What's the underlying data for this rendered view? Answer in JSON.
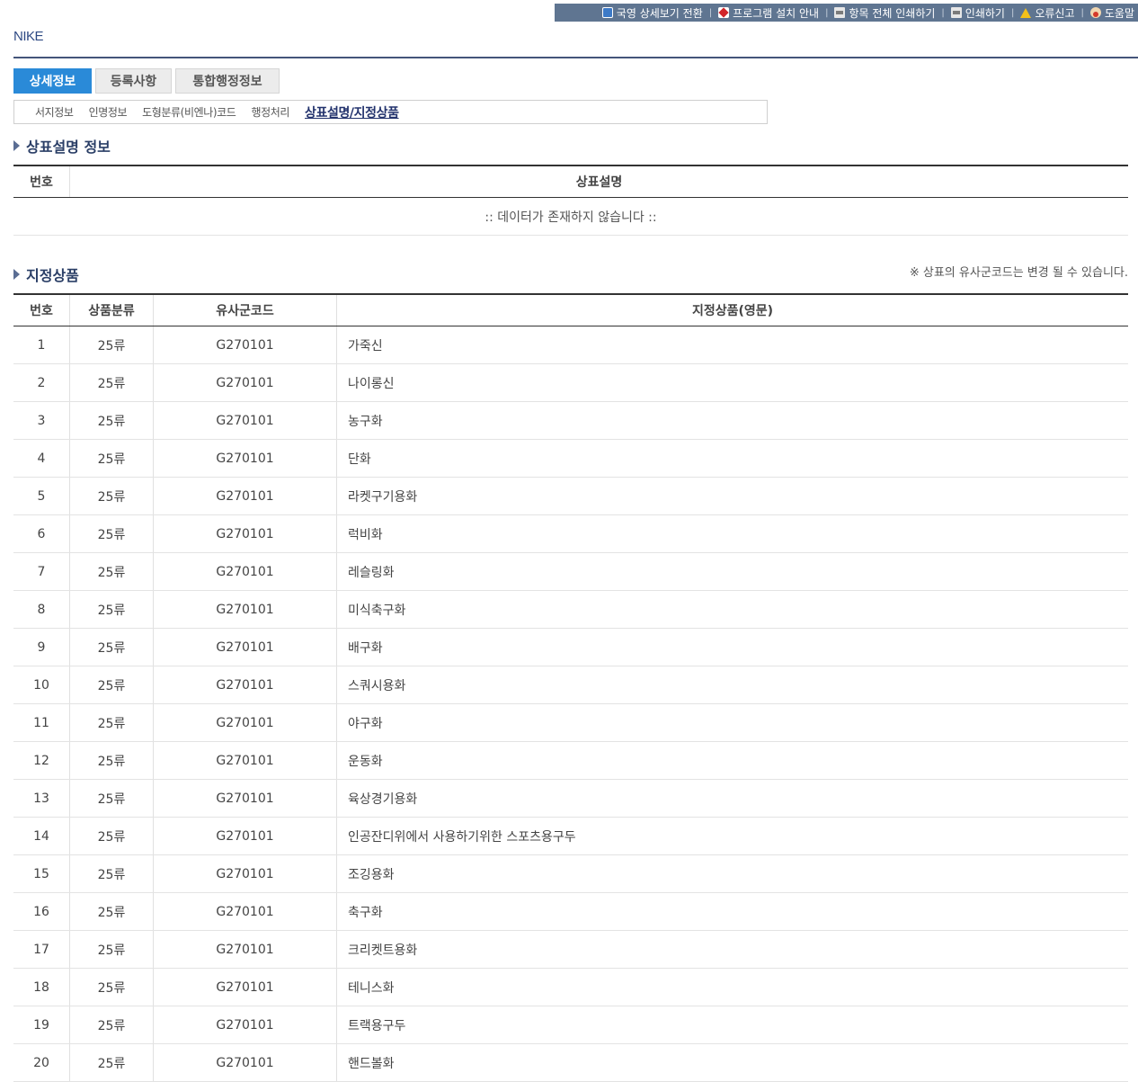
{
  "toolbar": {
    "items": [
      {
        "label": "국영 상세보기 전환",
        "icon": "translate-icon"
      },
      {
        "label": "프로그램 설치 안내",
        "icon": "pdf-icon"
      },
      {
        "label": "항목 전체 인쇄하기",
        "icon": "printer-icon"
      },
      {
        "label": "인쇄하기",
        "icon": "printer-icon"
      },
      {
        "label": "오류신고",
        "icon": "warning-icon"
      },
      {
        "label": "도움말",
        "icon": "help-icon"
      }
    ]
  },
  "title": "NIKE",
  "tabs": [
    {
      "label": "상세정보",
      "active": true
    },
    {
      "label": "등록사항",
      "active": false
    },
    {
      "label": "통합행정정보",
      "active": false
    }
  ],
  "subtabs": [
    {
      "label": "서지정보"
    },
    {
      "label": "인명정보"
    },
    {
      "label": "도형분류(비엔나)코드"
    },
    {
      "label": "행정처리"
    },
    {
      "label": "상표설명/지정상품",
      "active": true
    }
  ],
  "description_section": {
    "title": "상표설명 정보",
    "headers": [
      "번호",
      "상표설명"
    ],
    "empty_message": ":: 데이터가 존재하지 않습니다 ::"
  },
  "goods_section": {
    "title": "지정상품",
    "note": "※ 상표의 유사군코드는 변경 될 수 있습니다.",
    "headers": [
      "번호",
      "상품분류",
      "유사군코드",
      "지정상품(영문)"
    ],
    "rows": [
      [
        "1",
        "25류",
        "G270101",
        "가죽신"
      ],
      [
        "2",
        "25류",
        "G270101",
        "나이롱신"
      ],
      [
        "3",
        "25류",
        "G270101",
        "농구화"
      ],
      [
        "4",
        "25류",
        "G270101",
        "단화"
      ],
      [
        "5",
        "25류",
        "G270101",
        "라켓구기용화"
      ],
      [
        "6",
        "25류",
        "G270101",
        "럭비화"
      ],
      [
        "7",
        "25류",
        "G270101",
        "레슬링화"
      ],
      [
        "8",
        "25류",
        "G270101",
        "미식축구화"
      ],
      [
        "9",
        "25류",
        "G270101",
        "배구화"
      ],
      [
        "10",
        "25류",
        "G270101",
        "스쿼시용화"
      ],
      [
        "11",
        "25류",
        "G270101",
        "야구화"
      ],
      [
        "12",
        "25류",
        "G270101",
        "운동화"
      ],
      [
        "13",
        "25류",
        "G270101",
        "육상경기용화"
      ],
      [
        "14",
        "25류",
        "G270101",
        "인공잔디위에서 사용하기위한 스포츠용구두"
      ],
      [
        "15",
        "25류",
        "G270101",
        "조깅용화"
      ],
      [
        "16",
        "25류",
        "G270101",
        "축구화"
      ],
      [
        "17",
        "25류",
        "G270101",
        "크리켓트용화"
      ],
      [
        "18",
        "25류",
        "G270101",
        "테니스화"
      ],
      [
        "19",
        "25류",
        "G270101",
        "트랙용구두"
      ],
      [
        "20",
        "25류",
        "G270101",
        "핸드볼화"
      ]
    ]
  }
}
